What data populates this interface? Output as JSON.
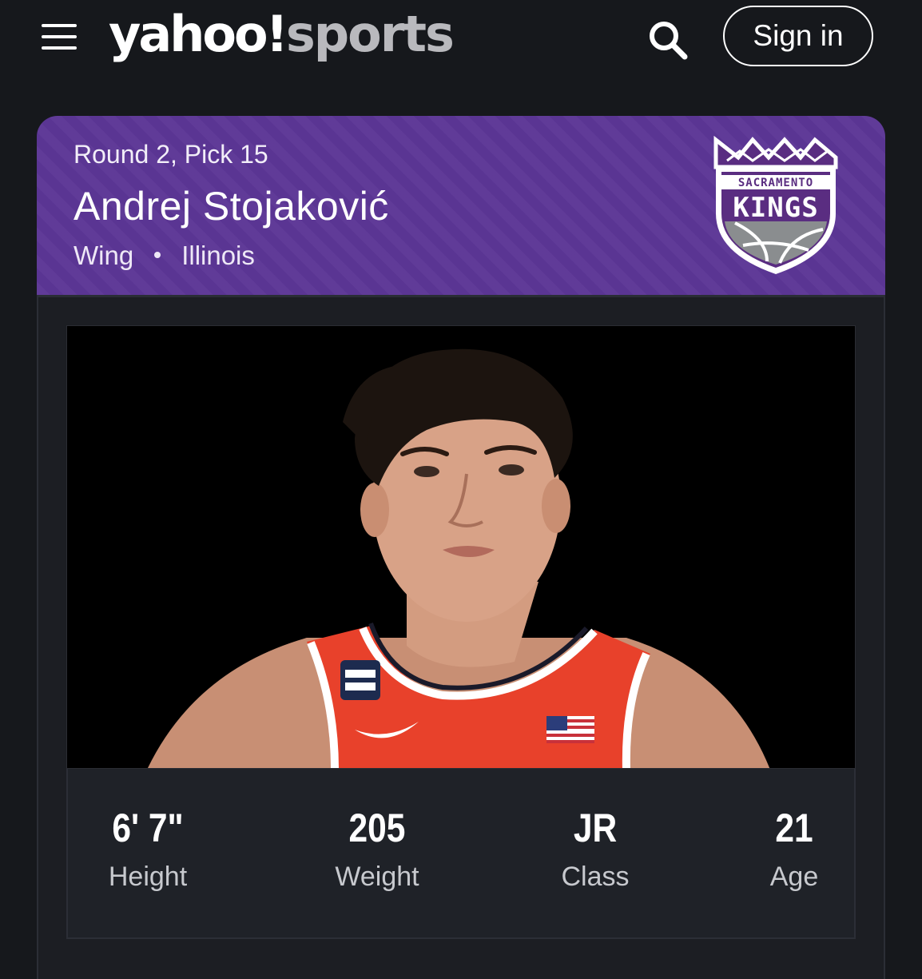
{
  "header": {
    "logo_main": "yahoo!",
    "logo_sub": "sports",
    "sign_in_label": "Sign in"
  },
  "icons": {
    "menu": "hamburger-menu-icon",
    "search": "search-icon"
  },
  "player": {
    "pick": "Round 2, Pick 15",
    "name": "Andrej Stojaković",
    "position": "Wing",
    "school": "Illinois",
    "team_logo_text_top": "SACRAMENTO",
    "team_logo_text_main": "KINGS"
  },
  "stats": [
    {
      "value": "6' 7\"",
      "label": "Height"
    },
    {
      "value": "205",
      "label": "Weight"
    },
    {
      "value": "JR",
      "label": "Class"
    },
    {
      "value": "21",
      "label": "Age"
    }
  ],
  "colors": {
    "background": "#16181c",
    "header_purple": "#5c3696",
    "kings_purple": "#5a2d81",
    "kings_gray": "#8a8d8f",
    "jersey_orange": "#e8412b"
  }
}
